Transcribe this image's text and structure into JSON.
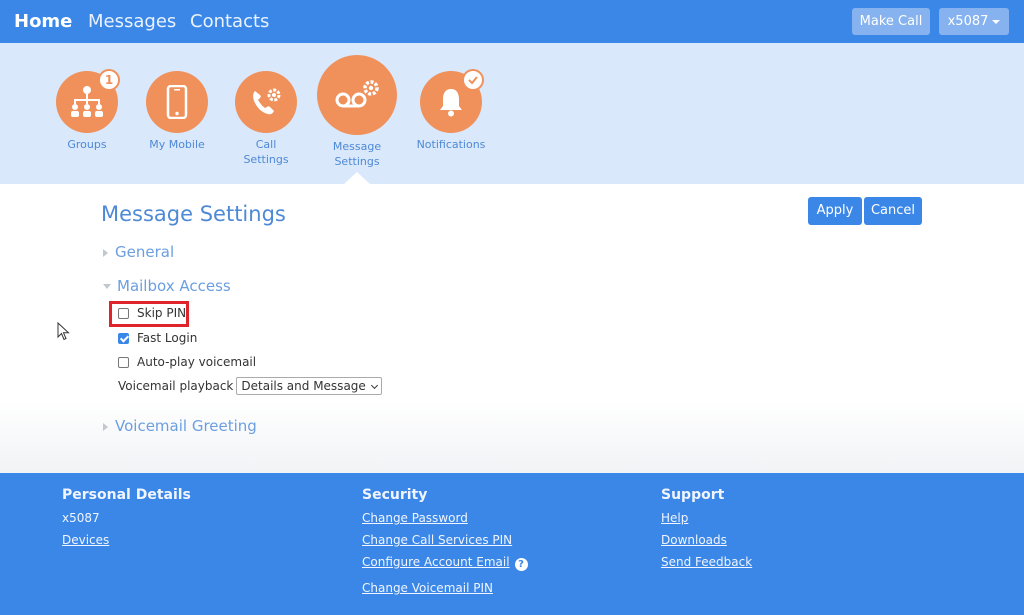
{
  "topnav": {
    "home": "Home",
    "messages": "Messages",
    "contacts": "Contacts",
    "make_call": "Make Call",
    "extension": "x5087"
  },
  "icons": {
    "groups": {
      "label": "Groups",
      "badge": "1"
    },
    "my_mobile": {
      "label": "My Mobile"
    },
    "call_settings": {
      "label_line1": "Call",
      "label_line2": "Settings"
    },
    "message_settings": {
      "label_line1": "Message",
      "label_line2": "Settings"
    },
    "notifications": {
      "label": "Notifications"
    }
  },
  "main": {
    "title": "Message Settings",
    "apply": "Apply",
    "cancel": "Cancel",
    "sections": {
      "general": "General",
      "mailbox_access": "Mailbox Access",
      "voicemail_greeting": "Voicemail Greeting"
    },
    "options": {
      "skip_pin": {
        "label": "Skip PIN",
        "checked": false
      },
      "fast_login": {
        "label": "Fast Login",
        "checked": true
      },
      "auto_play": {
        "label": "Auto-play voicemail",
        "checked": false
      }
    },
    "voicemail_playback": {
      "label": "Voicemail playback",
      "selected": "Details and Message"
    }
  },
  "footer": {
    "personal": {
      "heading": "Personal Details",
      "extension": "x5087",
      "devices": "Devices"
    },
    "security": {
      "heading": "Security",
      "change_password": "Change Password",
      "change_call_services_pin": "Change Call Services PIN",
      "configure_account_email": "Configure Account Email",
      "change_voicemail_pin": "Change Voicemail PIN"
    },
    "support": {
      "heading": "Support",
      "help": "Help",
      "downloads": "Downloads",
      "send_feedback": "Send Feedback"
    }
  },
  "colors": {
    "primary_blue": "#3a87e8",
    "accent_orange": "#f0905a",
    "band_blue": "#d9e8fb",
    "highlight_red": "#e0242b"
  }
}
